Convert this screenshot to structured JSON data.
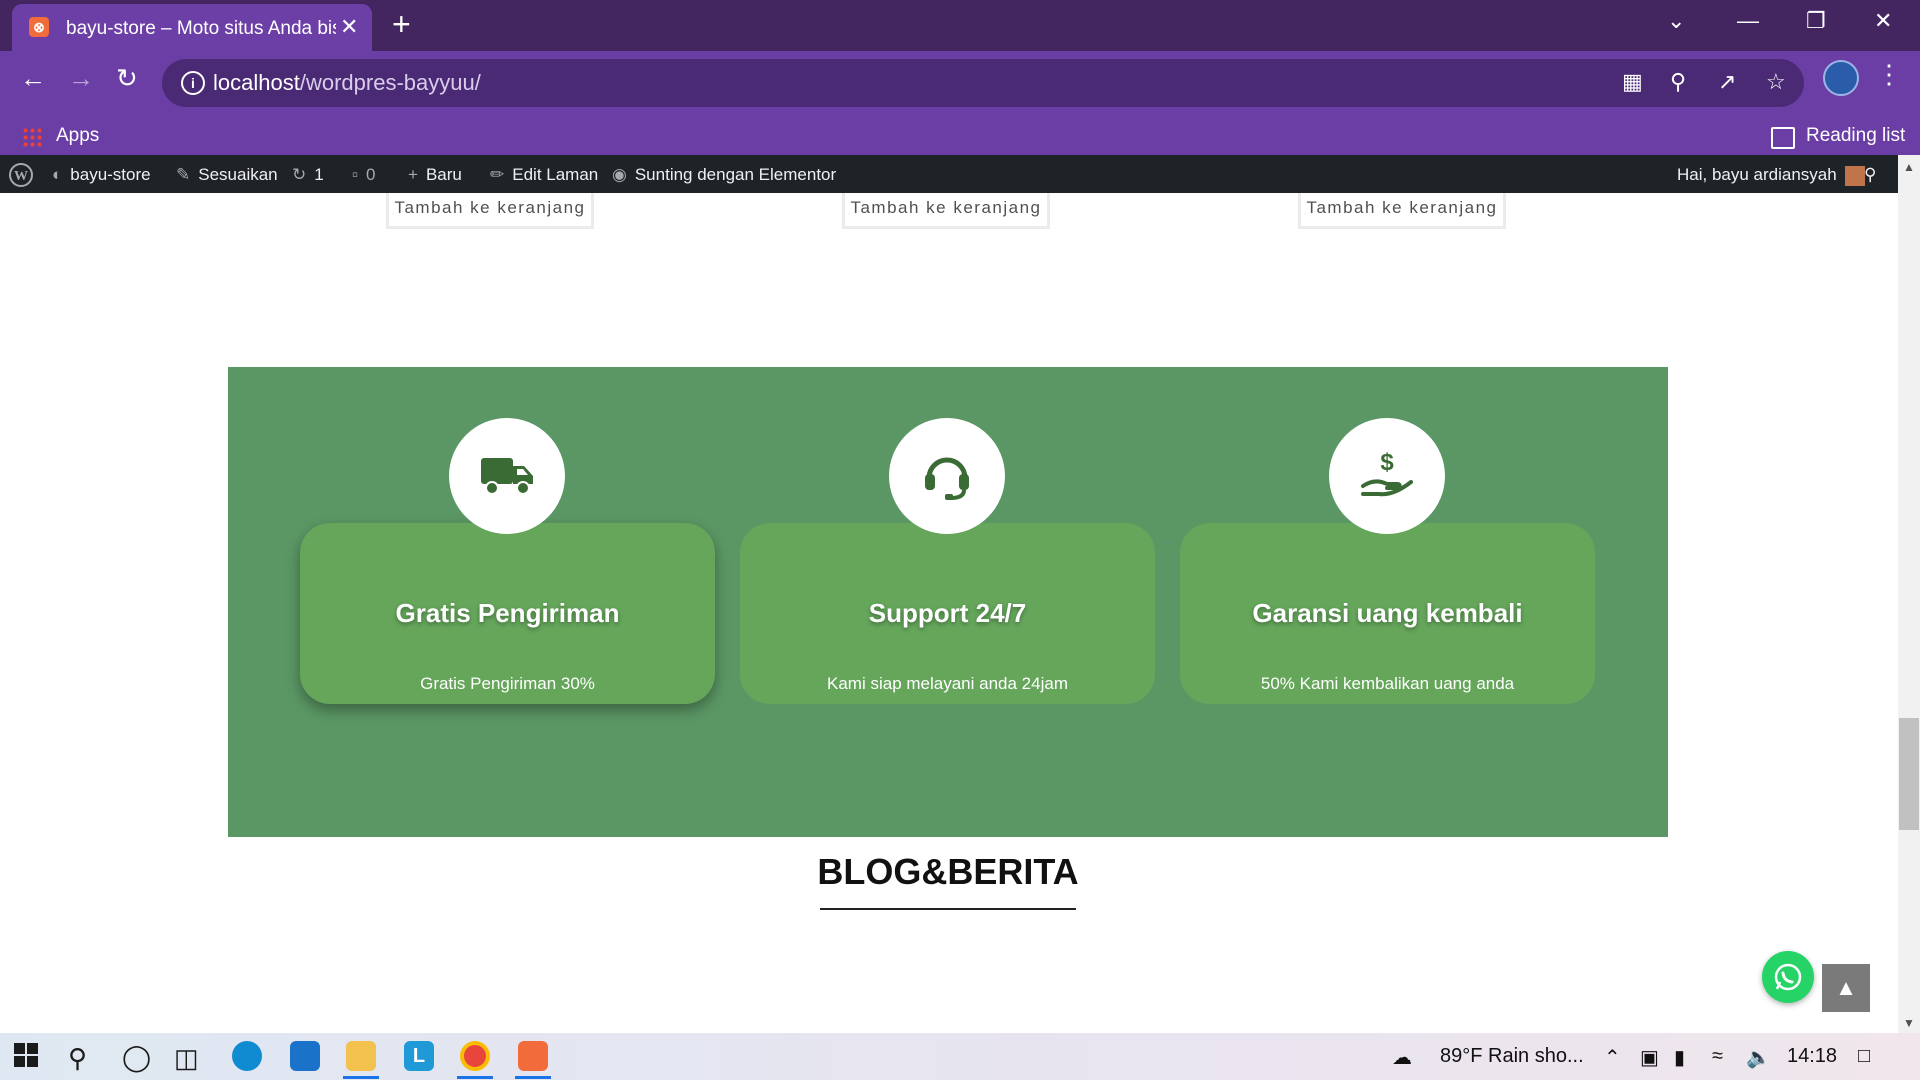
{
  "browser": {
    "tab_title": "bayu-store – Moto situs Anda bis",
    "url_host": "localhost",
    "url_path": "/wordpres-bayyuu/",
    "bookmarks": {
      "apps": "Apps",
      "reading_list": "Reading list"
    }
  },
  "admin_bar": {
    "site": "bayu-store",
    "customize": "Sesuaikan",
    "updates_count": "1",
    "comments_count": "0",
    "new": "Baru",
    "edit_page": "Edit Laman",
    "elementor": "Sunting dengan Elementor",
    "greeting": "Hai, bayu ardiansyah"
  },
  "products": {
    "add_to_cart": "Tambah ke keranjang"
  },
  "features": [
    {
      "title": "Gratis Pengiriman",
      "desc": "Gratis Pengiriman 30%",
      "icon": "truck-icon"
    },
    {
      "title": "Support 24/7",
      "desc": "Kami siap melayani anda 24jam",
      "icon": "headset-icon"
    },
    {
      "title": "Garansi uang kembali",
      "desc": "50% Kami kembalikan uang anda",
      "icon": "money-hand-icon"
    }
  ],
  "blog": {
    "heading": "BLOG&BERITA"
  },
  "taskbar": {
    "weather": "89°F  Rain sho...",
    "time": "14:18"
  },
  "colors": {
    "features_bg": "#5b9765",
    "card_bg": "#65a65b",
    "icon_green": "#3a6b35",
    "browser_purple": "#6b3ea6"
  }
}
